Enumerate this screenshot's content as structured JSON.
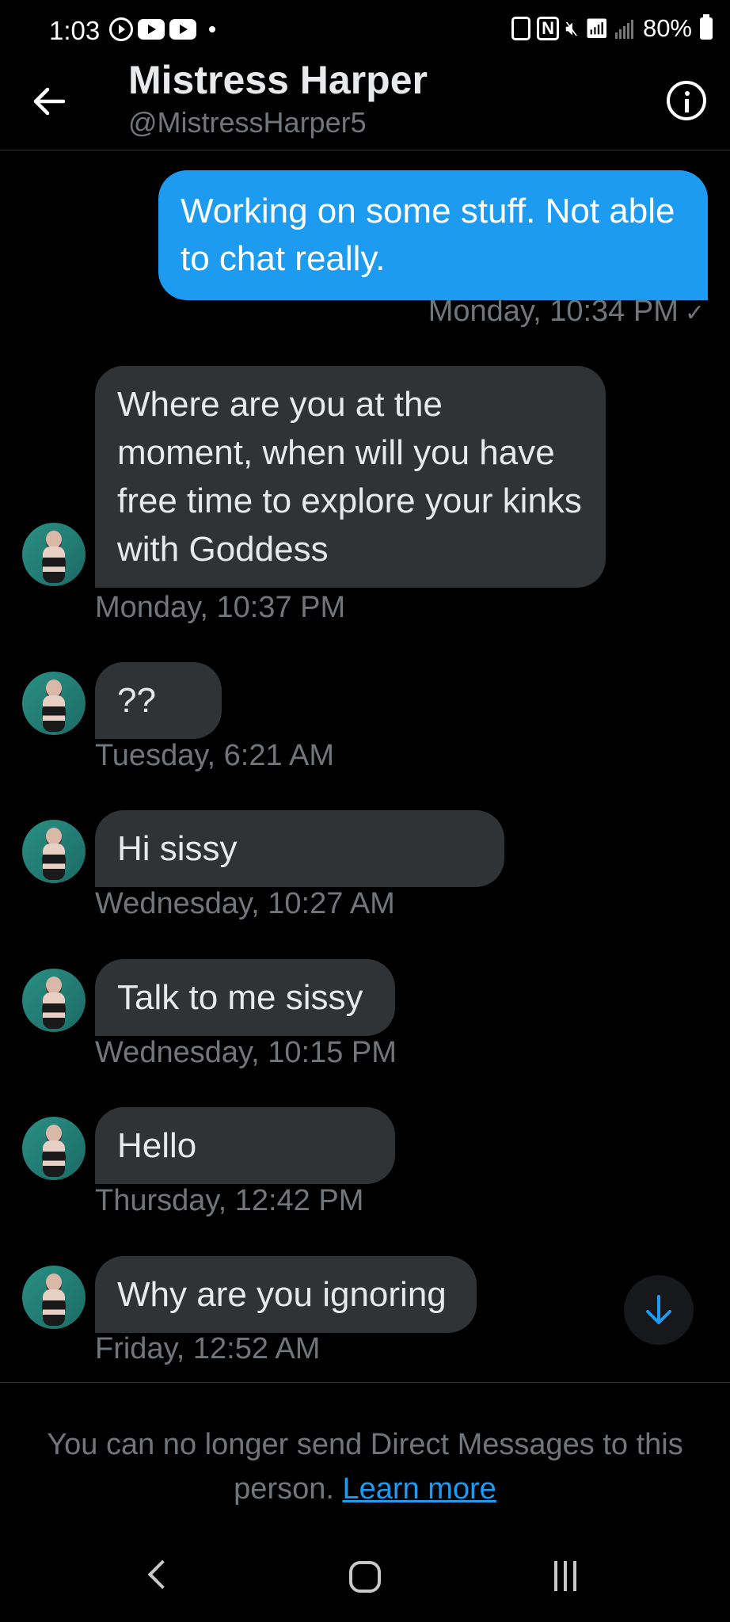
{
  "status_bar": {
    "time": "1:03",
    "battery": "80%"
  },
  "header": {
    "title": "Mistress Harper",
    "handle": "@MistressHarper5"
  },
  "outgoing": {
    "text": "Working on some stuff. Not able to chat really.",
    "timestamp": "Monday, 10:34 PM",
    "check": "✓"
  },
  "incoming": [
    {
      "text": "Where are you at the moment, when will you have free time to explore your kinks with Goddess",
      "timestamp": "Monday, 10:37 PM"
    },
    {
      "text": "??",
      "timestamp": "Tuesday, 6:21 AM"
    },
    {
      "text": "Hi sissy",
      "timestamp": "Wednesday, 10:27 AM"
    },
    {
      "text": "Talk to me sissy",
      "timestamp": "Wednesday, 10:15 PM"
    },
    {
      "text": "Hello",
      "timestamp": "Thursday, 12:42 PM"
    },
    {
      "text": "Why are you ignoring",
      "timestamp": "Friday, 12:52 AM"
    }
  ],
  "footer": {
    "notice": "You can no longer send Direct Messages to this person.",
    "link": "Learn more"
  },
  "colors": {
    "accent": "#1d9bf0",
    "bubble_in": "#2f3336",
    "background": "#000000"
  }
}
